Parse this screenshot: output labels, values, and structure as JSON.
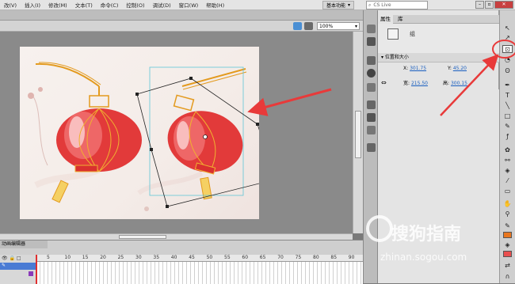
{
  "menubar": {
    "items": [
      "改(V)",
      "插入(I)",
      "修改(M)",
      "文本(T)",
      "命令(C)",
      "控制(O)",
      "调试(D)",
      "窗口(W)",
      "帮助(H)"
    ],
    "workspace_label": "基本功能",
    "search_label": "CS Live"
  },
  "stage": {
    "zoom_value": "100%"
  },
  "properties": {
    "tab_properties": "属性",
    "tab_library": "库",
    "instance_name": "组",
    "section_title": "位置和大小",
    "x_label": "X:",
    "x_value": "301.75",
    "y_label": "Y:",
    "y_value": "45.20",
    "w_label": "宽:",
    "w_value": "215.50",
    "h_label": "高:",
    "h_value": "300.15"
  },
  "timeline": {
    "tab_label": "动画编辑器",
    "frame_numbers": [
      "5",
      "10",
      "15",
      "20",
      "25",
      "30",
      "35",
      "40",
      "45",
      "50",
      "55",
      "60",
      "65",
      "70",
      "75",
      "80",
      "85",
      "90"
    ]
  },
  "watermark": {
    "brand": "搜狗指南",
    "url": "zhinan.sogou.com"
  },
  "colors": {
    "annotation_red": "#e83a3a",
    "lantern_red": "#e23a3a",
    "selection_cyan": "#5fc6d6"
  }
}
